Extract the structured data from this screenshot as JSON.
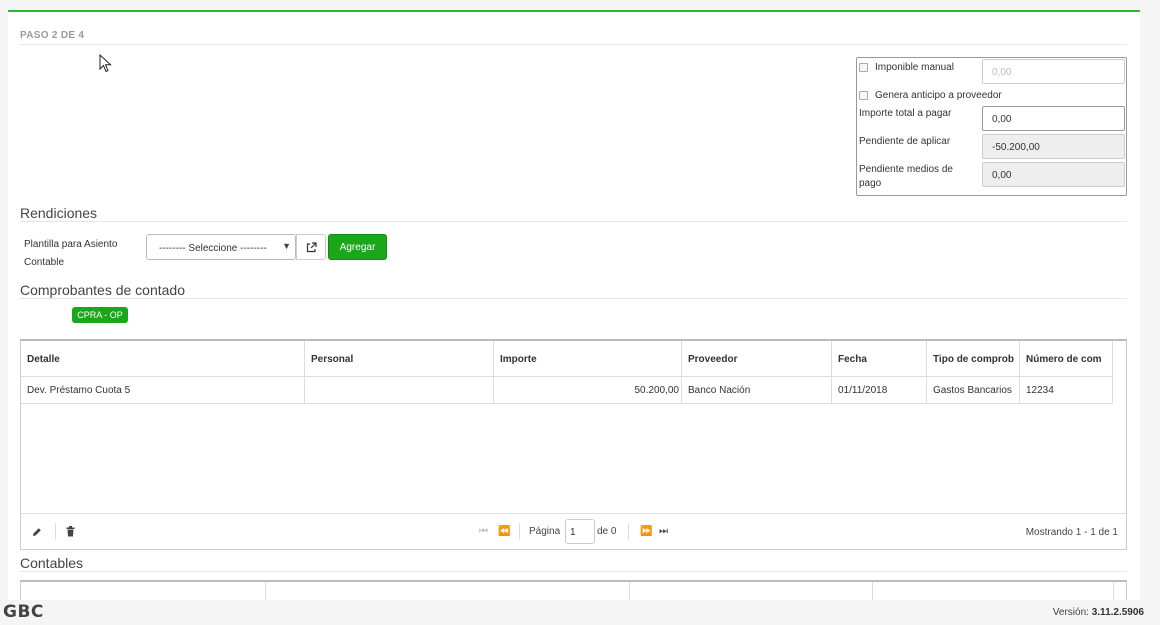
{
  "step_label": "PASO 2 DE 4",
  "summary": {
    "imponible_manual_label": "Imponible manual",
    "imponible_manual_placeholder": "0,00",
    "genera_anticipo_label": "Genera anticipo a proveedor",
    "importe_total_label": "Importe total a pagar",
    "importe_total_value": "0,00",
    "pendiente_aplicar_label": "Pendiente de aplicar",
    "pendiente_aplicar_value": "-50.200,00",
    "pendiente_medios_label": "Pendiente medios de pago",
    "pendiente_medios_value": "0,00"
  },
  "rendiciones": {
    "title": "Rendiciones",
    "plantilla_label": "Plantilla para Asiento Contable",
    "select_value": "-------- Seleccione --------",
    "agregar_label": "Agregar"
  },
  "comprobantes": {
    "title": "Comprobantes de contado",
    "tag": "CPRA - OP",
    "columns": [
      "Detalle",
      "Personal",
      "Importe",
      "Proveedor",
      "Fecha",
      "Tipo de comprob",
      "Número de com"
    ],
    "rows": [
      [
        "Dev. Préstamo Cuota 5",
        "",
        "50.200,00",
        "Banco Nación",
        "01/11/2018",
        "Gastos Bancarios",
        "12234"
      ]
    ],
    "pager": {
      "page_label": "Página",
      "page_value": "1",
      "of_label": "de 0",
      "showing": "Mostrando 1 - 1 de 1"
    }
  },
  "contables": {
    "title": "Contables"
  },
  "footer": {
    "logo": "GBC",
    "version_label": "Versión:",
    "version_value": "3.11.2.5906"
  },
  "colors": {
    "accent": "#1aa71a",
    "top_border": "#2fb52f"
  },
  "icons": [
    "cursor-icon",
    "external-link-icon",
    "edit-icon",
    "trash-icon",
    "first-page-icon",
    "prev-page-icon",
    "next-page-icon",
    "last-page-icon"
  ]
}
